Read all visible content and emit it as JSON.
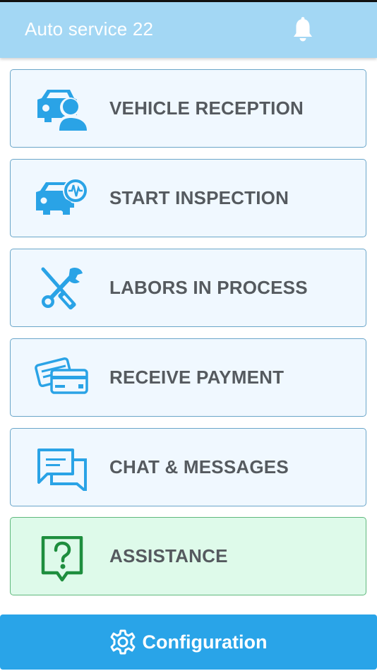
{
  "header": {
    "title": "Auto service 22",
    "bell_icon": "bell-icon"
  },
  "menu": [
    {
      "label": "VEHICLE RECEPTION",
      "icon": "car-person-icon"
    },
    {
      "label": "START INSPECTION",
      "icon": "car-diagnostic-icon"
    },
    {
      "label": "LABORS IN PROCESS",
      "icon": "wrench-screwdriver-icon"
    },
    {
      "label": "RECEIVE PAYMENT",
      "icon": "credit-cards-icon"
    },
    {
      "label": "CHAT & MESSAGES",
      "icon": "chat-bubbles-icon"
    },
    {
      "label": "ASSISTANCE",
      "icon": "question-bubble-icon"
    }
  ],
  "footer": {
    "config_label": "Configuration",
    "config_icon": "gear-icon"
  },
  "colors": {
    "header_bg": "#a3d7f4",
    "icon_blue": "#2aa3e6",
    "icon_green": "#1e8e3e",
    "card_bg": "#f0f8ff",
    "assist_bg": "#defaea",
    "config_bg": "#29a4e8",
    "label_text": "#555a5f"
  }
}
